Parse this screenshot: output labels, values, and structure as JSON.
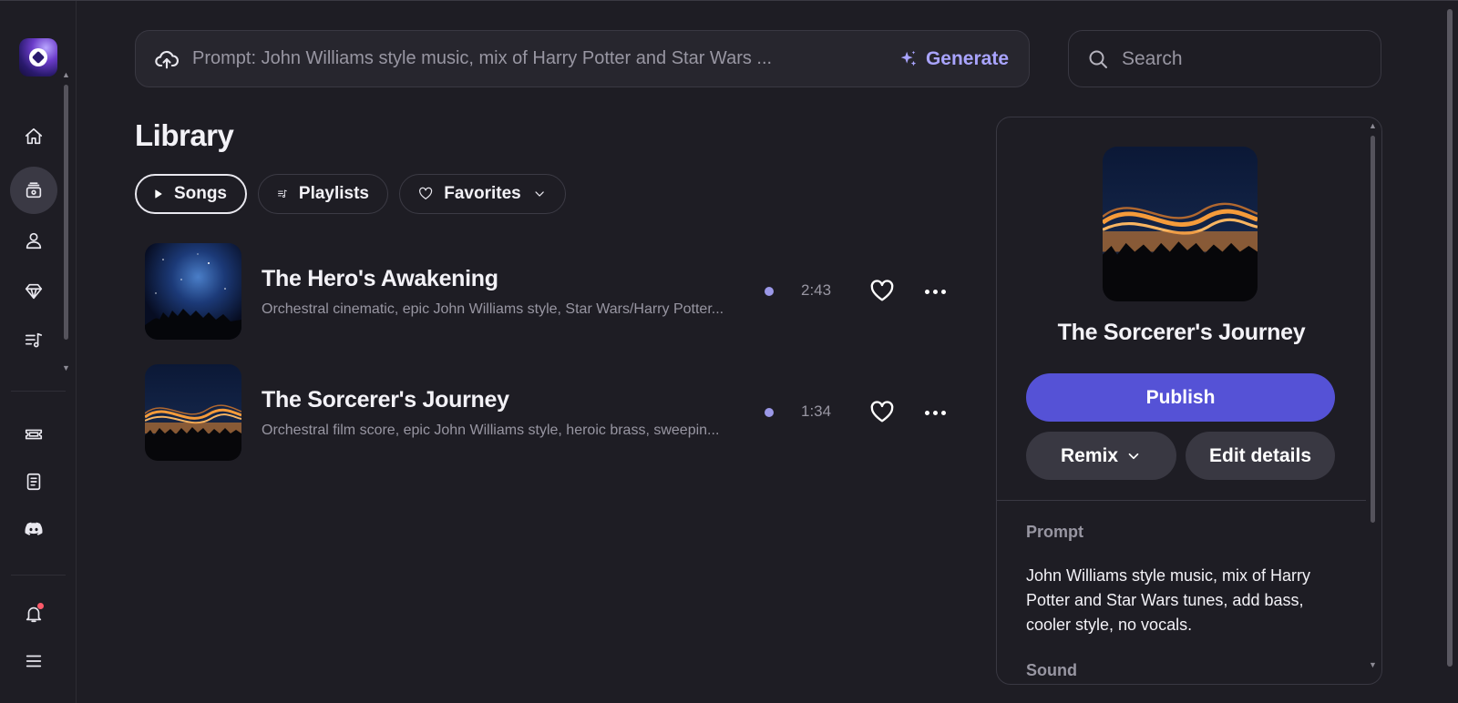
{
  "prompt_bar": {
    "text": "Prompt: John Williams style music, mix of Harry Potter and Star Wars ...",
    "generate_label": "Generate"
  },
  "search": {
    "placeholder": "Search"
  },
  "library": {
    "title": "Library",
    "tabs": [
      {
        "label": "Songs",
        "active": true
      },
      {
        "label": "Playlists",
        "active": false
      },
      {
        "label": "Favorites",
        "active": false
      }
    ],
    "songs": [
      {
        "title": "The Hero's Awakening",
        "description": "Orchestral cinematic, epic John Williams style, Star Wars/Harry Potter...",
        "duration": "2:43"
      },
      {
        "title": "The Sorcerer's Journey",
        "description": "Orchestral film score, epic John Williams style, heroic brass, sweepin...",
        "duration": "1:34"
      }
    ]
  },
  "detail": {
    "title": "The Sorcerer's Journey",
    "publish_label": "Publish",
    "remix_label": "Remix",
    "edit_label": "Edit details",
    "prompt_label": "Prompt",
    "prompt_text": "John Williams style music, mix of Harry Potter and Star Wars tunes, add bass, cooler style, no vocals.",
    "sound_label": "Sound"
  },
  "sidebar": {
    "icons": [
      "logo",
      "home-icon",
      "library-icon",
      "profile-icon",
      "gem-icon",
      "playlist-icon",
      "ticket-icon",
      "document-icon",
      "discord-icon",
      "bell-icon",
      "menu-icon"
    ]
  },
  "colors": {
    "background": "#1e1d24",
    "accent": "#5552d6",
    "generate": "#a9a4ff",
    "muted_text": "#9896a2"
  }
}
